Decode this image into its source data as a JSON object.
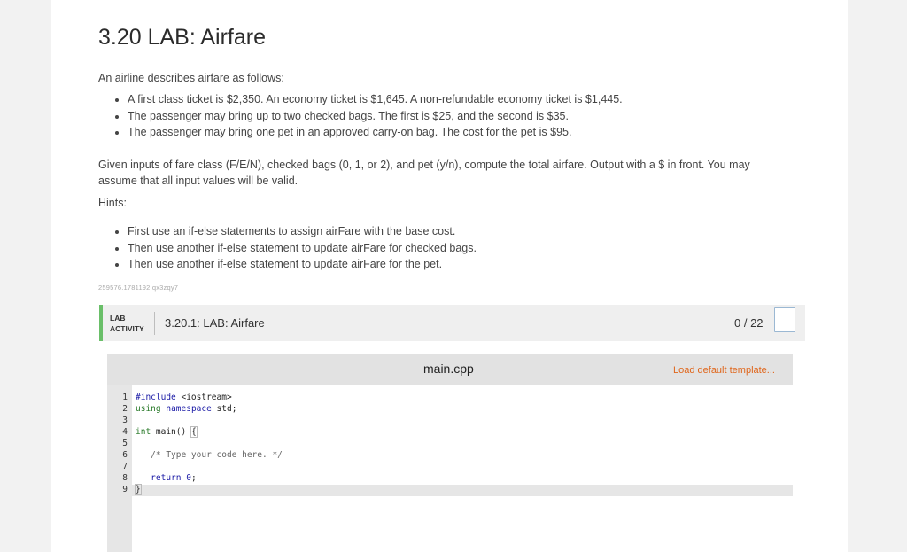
{
  "title": "3.20 LAB: Airfare",
  "intro": "An airline describes airfare as follows:",
  "rules": [
    "A first class ticket is $2,350. An economy ticket is $1,645. A non-refundable economy ticket is $1,445.",
    "The passenger may bring up to two checked bags. The first is $25, and the second is $35.",
    "The passenger may bring one pet in an approved carry-on bag. The cost for the pet is $95."
  ],
  "given": "Given inputs of fare class (F/E/N), checked bags (0, 1, or 2), and pet (y/n), compute the total airfare. Output with a $ in front. You may assume that all input values will be valid.",
  "hints_label": "Hints:",
  "hints": [
    "First use an if-else statements to assign airFare with the base cost.",
    "Then use another if-else statement to update airFare for checked bags.",
    "Then use another if-else statement to update airFare for the pet."
  ],
  "code_id": "259576.1781192.qx3zqy7",
  "lab": {
    "tag_line1": "LAB",
    "tag_line2": "ACTIVITY",
    "name": "3.20.1: LAB: Airfare",
    "score": "0 / 22"
  },
  "editor": {
    "filename": "main.cpp",
    "load_template": "Load default template...",
    "line_numbers": [
      "1",
      "2",
      "3",
      "4",
      "5",
      "6",
      "7",
      "8",
      "9"
    ],
    "accent_color": "#e0661b"
  },
  "colors": {
    "lab_accent": "#6abf69",
    "keyword": "#1a1aa6"
  }
}
